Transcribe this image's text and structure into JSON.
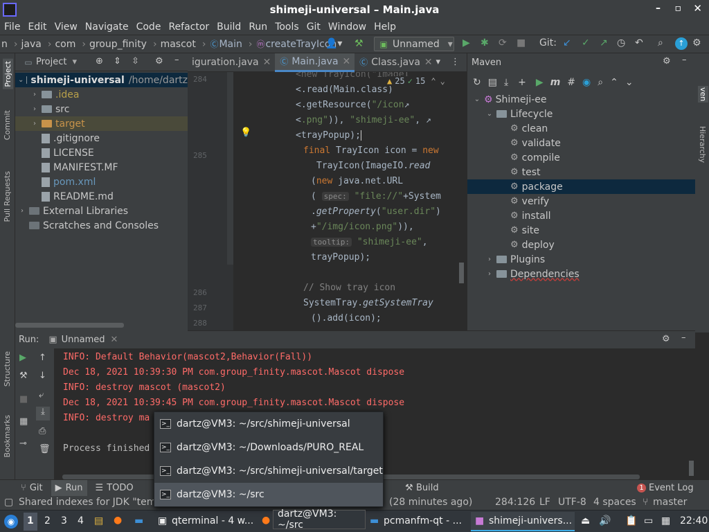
{
  "window": {
    "title": "shimeji-universal – Main.java"
  },
  "menu": [
    "File",
    "Edit",
    "View",
    "Navigate",
    "Code",
    "Refactor",
    "Build",
    "Run",
    "Tools",
    "Git",
    "Window",
    "Help"
  ],
  "nav": {
    "crumbs": [
      "n",
      "java",
      "com",
      "group_finity",
      "mascot",
      "Main",
      "createTrayIcon"
    ],
    "run_config": "Unnamed",
    "git_label": "Git:"
  },
  "left_strip": [
    "Project",
    "Commit",
    "Pull Requests",
    "Structure",
    "Bookmarks"
  ],
  "project": {
    "title": "Project",
    "root": "shimeji-universal",
    "root_path": "/home/dartz",
    "items": [
      {
        "name": ".idea",
        "type": "folder",
        "color": "#b8a04a",
        "depth": 1,
        "arrow": "›"
      },
      {
        "name": "src",
        "type": "folder",
        "color": "#c8c8c8",
        "depth": 1,
        "arrow": "›"
      },
      {
        "name": "target",
        "type": "folder",
        "color": "#c8934a",
        "depth": 1,
        "arrow": "›",
        "hl": true
      },
      {
        "name": ".gitignore",
        "type": "file",
        "color": "#c8c8c8",
        "depth": 1,
        "arrow": ""
      },
      {
        "name": "LICENSE",
        "type": "file",
        "color": "#c8c8c8",
        "depth": 1,
        "arrow": ""
      },
      {
        "name": "MANIFEST.MF",
        "type": "file",
        "color": "#c8c8c8",
        "depth": 1,
        "arrow": ""
      },
      {
        "name": "pom.xml",
        "type": "file",
        "color": "#6897bb",
        "depth": 1,
        "arrow": ""
      },
      {
        "name": "README.md",
        "type": "file",
        "color": "#c8c8c8",
        "depth": 1,
        "arrow": ""
      },
      {
        "name": "External Libraries",
        "type": "lib",
        "color": "#c8c8c8",
        "depth": 0,
        "arrow": "›"
      },
      {
        "name": "Scratches and Consoles",
        "type": "lib",
        "color": "#c8c8c8",
        "depth": 0,
        "arrow": ""
      }
    ]
  },
  "editor": {
    "tabs": [
      "iguration.java",
      "Main.java",
      "Class.java"
    ],
    "warnings": "25",
    "ok": "15",
    "gutter": [
      "284",
      "",
      "",
      "",
      "",
      "285",
      "",
      "",
      "",
      "",
      "",
      "",
      "",
      "",
      "286",
      "287",
      "288"
    ]
  },
  "maven": {
    "title": "Maven",
    "root": "Shimeji-ee",
    "lifecycle": "Lifecycle",
    "phases": [
      "clean",
      "validate",
      "compile",
      "test",
      "package",
      "verify",
      "install",
      "site",
      "deploy"
    ],
    "selected": "package",
    "plugins": "Plugins",
    "deps": "Dependencies"
  },
  "right_strip": [
    "ven",
    "Hierarchy"
  ],
  "run": {
    "label": "Run:",
    "config": "Unnamed",
    "lines": [
      {
        "t": "INFO: Default Behavior(mascot2,Behavior(Fall))",
        "c": "err"
      },
      {
        "t": "Dec 18, 2021 10:39:30 PM com.group_finity.mascot.Mascot dispose",
        "c": "err"
      },
      {
        "t": "INFO: destroy mascot (mascot2)",
        "c": "err"
      },
      {
        "t": "Dec 18, 2021 10:39:45 PM com.group_finity.mascot.Mascot dispose",
        "c": "err"
      },
      {
        "t": "INFO: destroy ma",
        "c": "err"
      },
      {
        "t": "",
        "c": ""
      },
      {
        "t": "Process finished",
        "c": "out"
      }
    ]
  },
  "bottom_tabs": [
    "Git",
    "Run",
    "TODO",
    "Build",
    "Event Log"
  ],
  "event_count": "1",
  "status": {
    "left": "Shared indexes for JDK \"temu",
    "time": "(28 minutes ago)",
    "pos": "284:126",
    "lf": "LF",
    "enc": "UTF-8",
    "indent": "4 spaces",
    "branch": "master"
  },
  "popup": [
    "dartz@VM3: ~/src/shimeji-universal",
    "dartz@VM3: ~/Downloads/PURO_REAL",
    "dartz@VM3: ~/src/shimeji-universal/target",
    "dartz@VM3: ~/src"
  ],
  "tooltip": "dartz@VM3: ~/src",
  "taskbar": {
    "desktops": [
      "1",
      "2",
      "3",
      "4"
    ],
    "tasks": [
      "qterminal - 4 w...",
      "pcmanfm-qt - ...",
      "shimeji-univers..."
    ],
    "clock": "22:40"
  }
}
